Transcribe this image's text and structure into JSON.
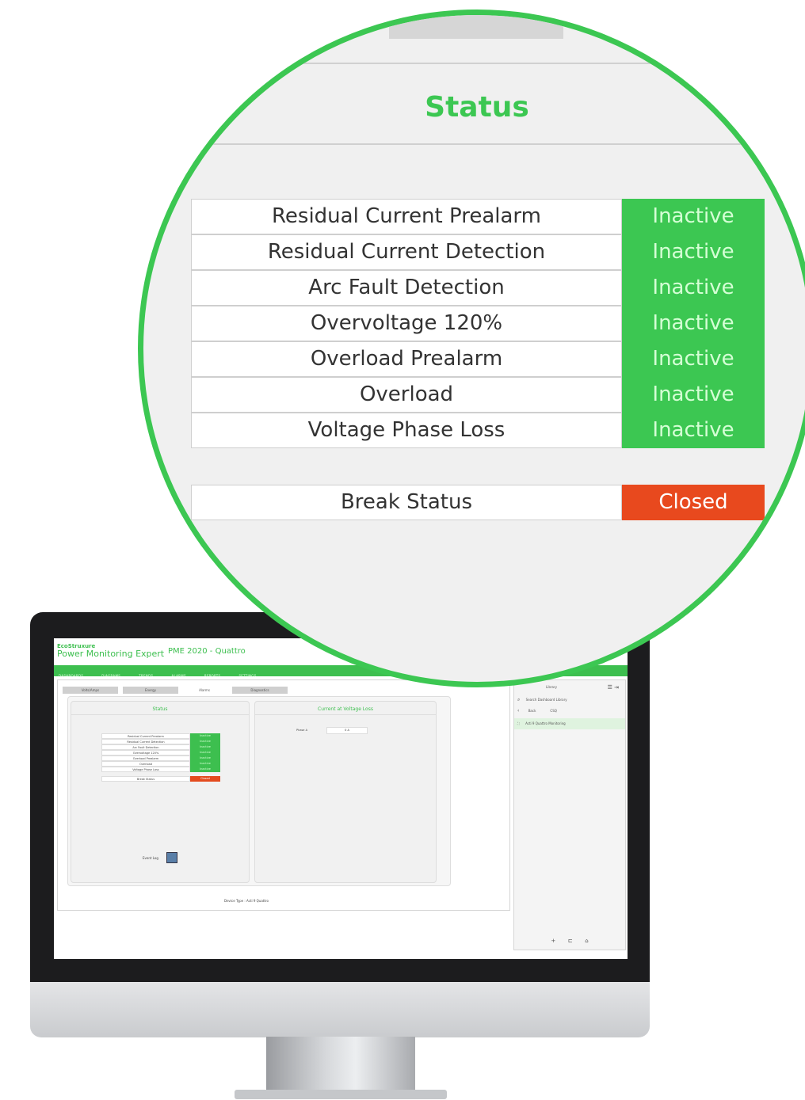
{
  "zoom": {
    "title": "Status",
    "rows": [
      {
        "label": "Residual Current Prealarm",
        "value": "Inactive"
      },
      {
        "label": "Residual Current Detection",
        "value": "Inactive"
      },
      {
        "label": "Arc Fault Detection",
        "value": "Inactive"
      },
      {
        "label": "Overvoltage 120%",
        "value": "Inactive"
      },
      {
        "label": "Overload Prealarm",
        "value": "Inactive"
      },
      {
        "label": "Overload",
        "value": "Inactive"
      },
      {
        "label": "Voltage Phase Loss",
        "value": "Inactive"
      }
    ],
    "break": {
      "label": "Break Status",
      "value": "Closed"
    }
  },
  "app": {
    "brand": "EcoStruxure",
    "product": "Power Monitoring Expert",
    "title": "PME 2020 - Quattro",
    "nav": [
      "DASHBOARDS",
      "DIAGRAMS",
      "TRENDS",
      "ALARMS",
      "REPORTS",
      "SETTINGS"
    ],
    "tabs": [
      "Volts/Amps",
      "Energy",
      "Alarms",
      "Diagnostics"
    ],
    "status_panel_title": "Status",
    "voltage_panel_title": "Current at Voltage Loss",
    "phase_label": "Phase A",
    "phase_value": "0 A",
    "event_log": "Event Log",
    "device_type": "Device Type : Acti 9 Quattro",
    "library": {
      "title": "Library",
      "search": "Search Dashboard Library",
      "back": "Back",
      "folder": "CSQ",
      "item": "Acti 9 Quattro Monitoring"
    }
  },
  "colors": {
    "green": "#3cc752",
    "red": "#e8491e"
  }
}
